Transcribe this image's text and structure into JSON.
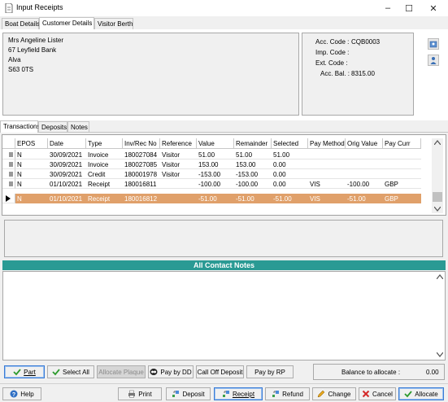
{
  "window": {
    "title": "Input Receipts",
    "controls": [
      "–",
      "☐",
      "✕"
    ]
  },
  "top_tabs": [
    "Boat Details",
    "Customer Details",
    "Visitor Berth"
  ],
  "active_top_tab": "Customer Details",
  "customer": {
    "address": [
      "Mrs Angeline Lister",
      "67 Leyfield Bank",
      "Alva",
      "S63 0TS"
    ]
  },
  "account": {
    "acc_code_label": "Acc. Code :",
    "acc_code": "CQB0003",
    "imp_code_label": "Imp. Code :",
    "imp_code": "",
    "ext_code_label": "Ext. Code :",
    "ext_code": "",
    "acc_bal_label": "Acc. Bal. :",
    "acc_bal": "8315.00"
  },
  "sub_tabs": [
    "Transactions",
    "Deposits",
    "Notes"
  ],
  "active_sub_tab": "Transactions",
  "grid": {
    "columns": [
      "EPOS",
      "Date",
      "Type",
      "Inv/Rec No",
      "Reference",
      "Value",
      "Remainder",
      "Selected",
      "Pay Method",
      "Orig Value",
      "Pay Curr"
    ],
    "rows": [
      [
        "N",
        "30/09/2021",
        "Invoice",
        "180027084",
        "Visitor",
        "51.00",
        "51.00",
        "51.00",
        "",
        "",
        ""
      ],
      [
        "N",
        "30/09/2021",
        "Invoice",
        "180027085",
        "Visitor",
        "153.00",
        "153.00",
        "0.00",
        "",
        "",
        ""
      ],
      [
        "N",
        "30/09/2021",
        "Credit",
        "180001978",
        "Visitor",
        "-153.00",
        "-153.00",
        "0.00",
        "",
        "",
        ""
      ],
      [
        "N",
        "01/10/2021",
        "Receipt",
        "180016811",
        "",
        "-100.00",
        "-100.00",
        "0.00",
        "VIS",
        "-100.00",
        "GBP"
      ],
      [
        "N",
        "01/10/2021",
        "Receipt",
        "180016812",
        "",
        "-51.00",
        "-51.00",
        "-51.00",
        "VIS",
        "-51.00",
        "GBP"
      ]
    ],
    "selected_row": 4
  },
  "notes": {
    "header": "All Contact Notes"
  },
  "action_buttons": {
    "part": "Part",
    "select_all": "Select All",
    "allocate_plaque": "Allocate Plaque",
    "pay_by_dd": "Pay by DD",
    "call_off_deposit": "Call Off Deposit",
    "pay_by_rp": "Pay by RP"
  },
  "balance": {
    "label": "Balance to allocate :",
    "value": "0.00"
  },
  "bottom_buttons": {
    "help": "Help",
    "print": "Print",
    "deposit": "Deposit",
    "receipt": "Receipt",
    "refund": "Refund",
    "change": "Change",
    "cancel": "Cancel",
    "allocate": "Allocate"
  },
  "colors": {
    "selected_row": "#e0a06a",
    "notes_header": "#2a9a94",
    "highlight_border": "#3a7bd5"
  }
}
